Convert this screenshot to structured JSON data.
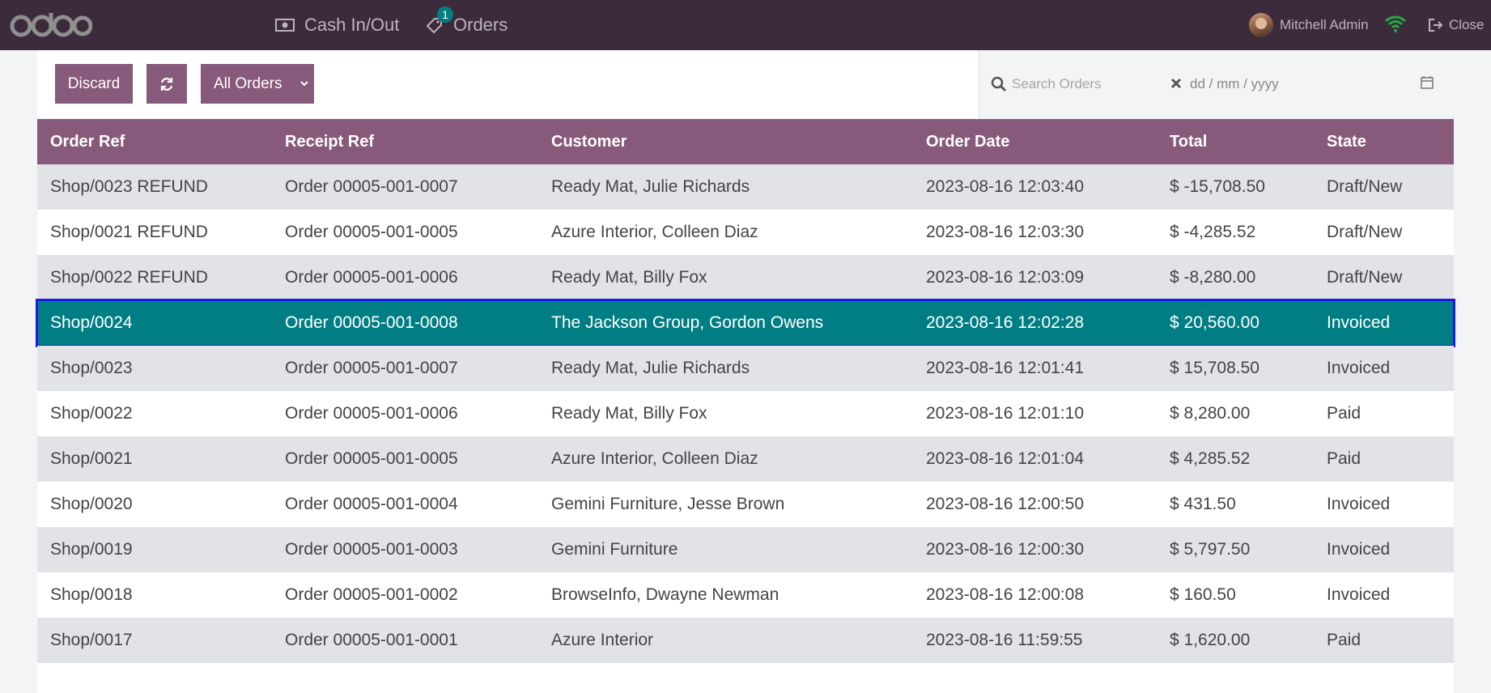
{
  "navbar": {
    "logo_text": "odoo",
    "cash_label": "Cash In/Out",
    "orders_label": "Orders",
    "orders_badge": "1",
    "user_name": "Mitchell Admin",
    "close_label": "Close"
  },
  "toolbar": {
    "discard_label": "Discard",
    "filter_label": "All Orders"
  },
  "search": {
    "placeholder": "Search Orders",
    "date_placeholder": "dd / mm / yyyy"
  },
  "table": {
    "headers": [
      "Order Ref",
      "Receipt Ref",
      "Customer",
      "Order Date",
      "Total",
      "State"
    ],
    "rows": [
      {
        "order_ref": "Shop/0023 REFUND",
        "receipt_ref": "Order 00005-001-0007",
        "customer": "Ready Mat, Julie Richards",
        "date": "2023-08-16 12:03:40",
        "total": "$ -15,708.50",
        "state": "Draft/New"
      },
      {
        "order_ref": "Shop/0021 REFUND",
        "receipt_ref": "Order 00005-001-0005",
        "customer": "Azure Interior, Colleen Diaz",
        "date": "2023-08-16 12:03:30",
        "total": "$ -4,285.52",
        "state": "Draft/New"
      },
      {
        "order_ref": "Shop/0022 REFUND",
        "receipt_ref": "Order 00005-001-0006",
        "customer": "Ready Mat, Billy Fox",
        "date": "2023-08-16 12:03:09",
        "total": "$ -8,280.00",
        "state": "Draft/New"
      },
      {
        "order_ref": "Shop/0024",
        "receipt_ref": "Order 00005-001-0008",
        "customer": "The Jackson Group, Gordon Owens",
        "date": "2023-08-16 12:02:28",
        "total": "$ 20,560.00",
        "state": "Invoiced"
      },
      {
        "order_ref": "Shop/0023",
        "receipt_ref": "Order 00005-001-0007",
        "customer": "Ready Mat, Julie Richards",
        "date": "2023-08-16 12:01:41",
        "total": "$ 15,708.50",
        "state": "Invoiced"
      },
      {
        "order_ref": "Shop/0022",
        "receipt_ref": "Order 00005-001-0006",
        "customer": "Ready Mat, Billy Fox",
        "date": "2023-08-16 12:01:10",
        "total": "$ 8,280.00",
        "state": "Paid"
      },
      {
        "order_ref": "Shop/0021",
        "receipt_ref": "Order 00005-001-0005",
        "customer": "Azure Interior, Colleen Diaz",
        "date": "2023-08-16 12:01:04",
        "total": "$ 4,285.52",
        "state": "Paid"
      },
      {
        "order_ref": "Shop/0020",
        "receipt_ref": "Order 00005-001-0004",
        "customer": "Gemini Furniture, Jesse Brown",
        "date": "2023-08-16 12:00:50",
        "total": "$ 431.50",
        "state": "Invoiced"
      },
      {
        "order_ref": "Shop/0019",
        "receipt_ref": "Order 00005-001-0003",
        "customer": "Gemini Furniture",
        "date": "2023-08-16 12:00:30",
        "total": "$ 5,797.50",
        "state": "Invoiced"
      },
      {
        "order_ref": "Shop/0018",
        "receipt_ref": "Order 00005-001-0002",
        "customer": "BrowseInfo, Dwayne Newman",
        "date": "2023-08-16 12:00:08",
        "total": "$ 160.50",
        "state": "Invoiced"
      },
      {
        "order_ref": "Shop/0017",
        "receipt_ref": "Order 00005-001-0001",
        "customer": "Azure Interior",
        "date": "2023-08-16 11:59:55",
        "total": "$ 1,620.00",
        "state": "Paid"
      }
    ]
  },
  "icons": {
    "cash": "money-bill-icon",
    "orders": "tag-icon",
    "wifi": "wifi-icon",
    "close": "sign-out-icon",
    "refresh": "refresh-icon",
    "search": "search-icon",
    "clear": "x-icon",
    "calendar": "calendar-icon"
  },
  "colors": {
    "navbar": "#3b2b3b",
    "primary": "#875a7b",
    "selected_row": "#017e84",
    "selected_outline": "#1a1ae6",
    "wifi": "#28a745"
  }
}
